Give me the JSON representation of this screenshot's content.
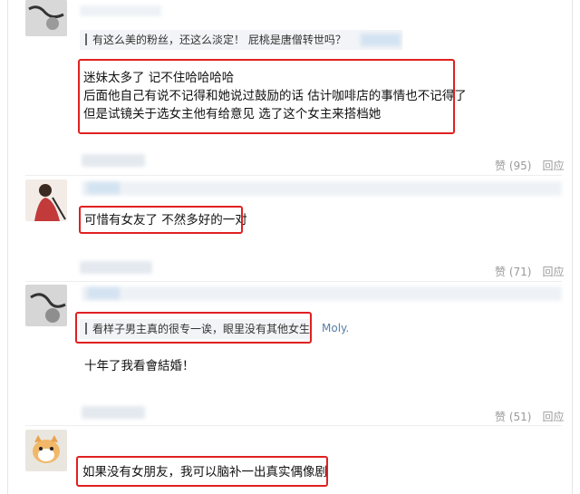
{
  "comments": [
    {
      "quote_text": "有这么美的粉丝，还这么淡定！ 屁桃是唐僧转世吗？",
      "reply_lines": [
        "迷妹太多了 记不住哈哈哈哈",
        "后面他自己有说不记得和她说过鼓励的话 估计咖啡店的事情也不记得了",
        "但是试镜关于选女主他有给意见 选了这个女主来搭档她"
      ],
      "like_label": "赞 (95)",
      "reply_label": "回应"
    },
    {
      "reply_text": "可惜有女友了 不然多好的一对",
      "like_label": "赞 (71)",
      "reply_label": "回应"
    },
    {
      "quote_text": "看样子男主真的很专一诶，眼里没有其他女生",
      "quote_user": "Moly.",
      "reply_text": "十年了我看會結婚！",
      "like_label": "赞 (51)",
      "reply_label": "回应"
    },
    {
      "reply_text": "如果没有女朋友，我可以脑补一出真实偶像剧"
    }
  ],
  "colors": {
    "highlight": "#e02020",
    "link": "#5a7ea8",
    "meta": "#999999"
  }
}
